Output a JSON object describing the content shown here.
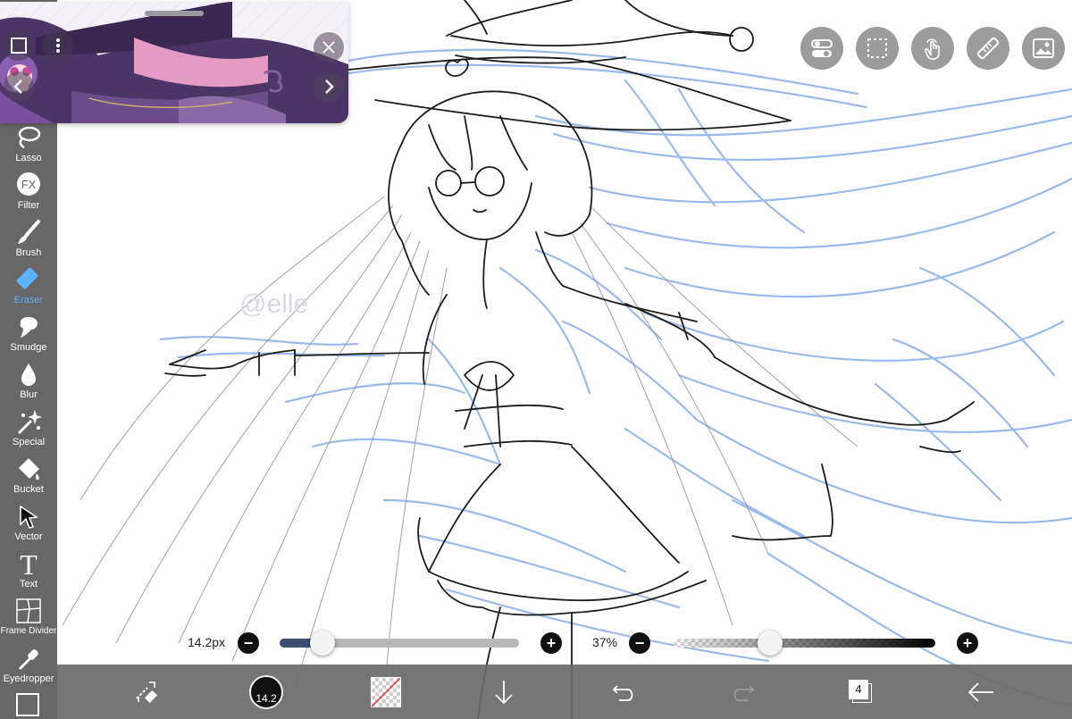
{
  "toolbar": {
    "tools": [
      {
        "label": "Lasso",
        "icon": "lasso-icon"
      },
      {
        "label": "Filter",
        "icon": "fx-icon"
      },
      {
        "label": "Brush",
        "icon": "brush-icon"
      },
      {
        "label": "Eraser",
        "icon": "eraser-icon",
        "active": true
      },
      {
        "label": "Smudge",
        "icon": "smudge-icon"
      },
      {
        "label": "Blur",
        "icon": "blur-icon"
      },
      {
        "label": "Special",
        "icon": "sparkle-icon"
      },
      {
        "label": "Bucket",
        "icon": "bucket-icon"
      },
      {
        "label": "Vector",
        "icon": "vector-arrow-icon"
      },
      {
        "label": "Text",
        "icon": "text-icon"
      },
      {
        "label": "Frame Divider",
        "icon": "frame-divider-icon"
      },
      {
        "label": "Eyedropper",
        "icon": "eyedropper-icon"
      }
    ],
    "active_color": "#5fb2ff"
  },
  "reference_window": {
    "icons": [
      "frame-icon",
      "more-icon",
      "prev-arrow-icon",
      "next-arrow-icon",
      "close-icon"
    ]
  },
  "top_buttons": [
    "toggle-icon",
    "selection-icon",
    "touch-icon",
    "ruler-icon",
    "image-icon"
  ],
  "brush_size": {
    "value_label": "14.2px",
    "fraction": 0.18
  },
  "opacity": {
    "value_label": "37%",
    "fraction": 0.37
  },
  "bottom_bar": {
    "brush_size_badge": "14.2",
    "layer_count": "4",
    "icons": [
      "swap-tools-icon",
      "color-circle-icon",
      "transparent-color-icon",
      "download-arrow-icon",
      "undo-icon",
      "redo-icon",
      "layers-icon",
      "back-arrow-icon"
    ]
  },
  "watermark": "@elle"
}
